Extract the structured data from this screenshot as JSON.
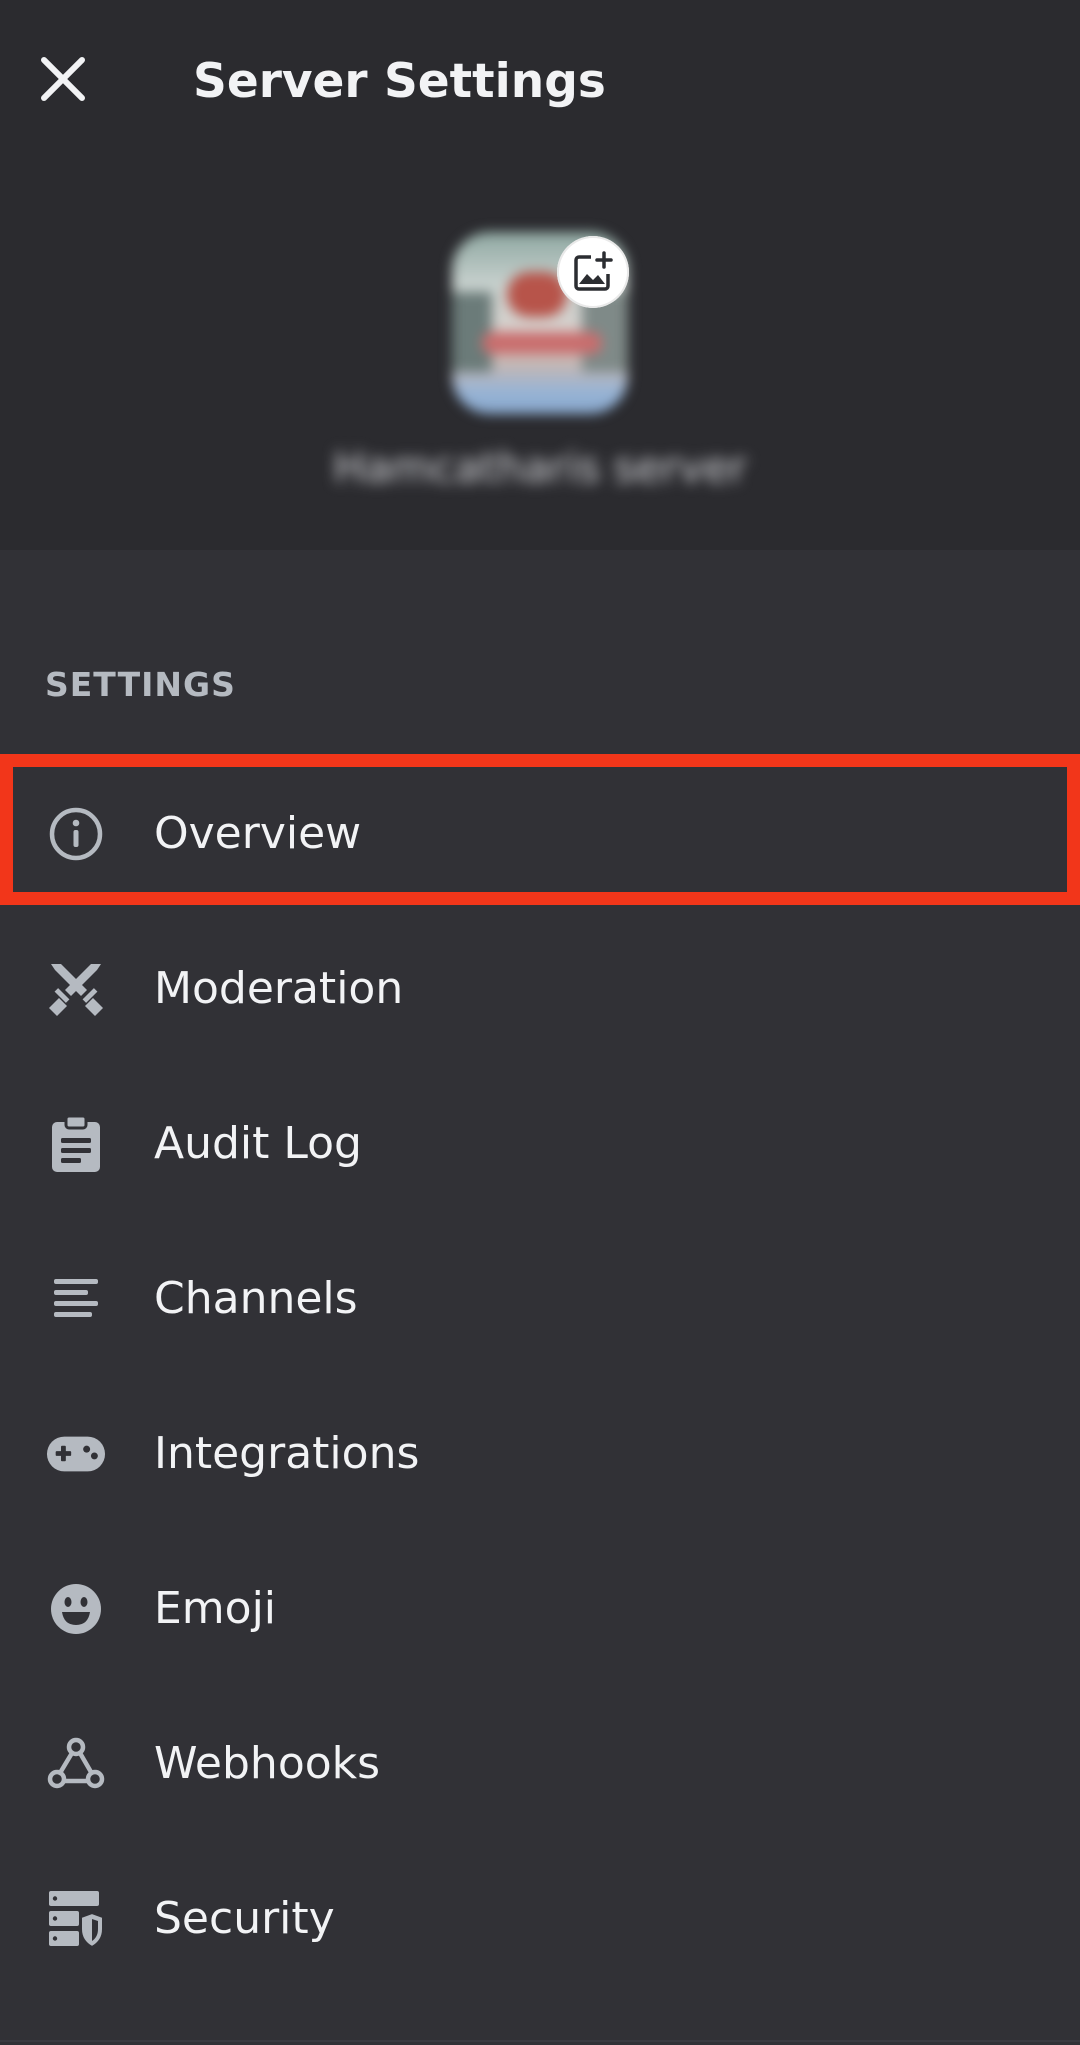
{
  "header": {
    "title": "Server Settings",
    "close_icon": "close-icon"
  },
  "server": {
    "name": "Hamcatharis server",
    "icon": "server-avatar",
    "upload_icon": "image-add-icon"
  },
  "settings_section": {
    "label": "SETTINGS",
    "items": [
      {
        "label": "Overview",
        "icon": "info-icon",
        "highlighted": true
      },
      {
        "label": "Moderation",
        "icon": "swords-icon"
      },
      {
        "label": "Audit Log",
        "icon": "clipboard-icon"
      },
      {
        "label": "Channels",
        "icon": "text-lines-icon"
      },
      {
        "label": "Integrations",
        "icon": "gamepad-icon"
      },
      {
        "label": "Emoji",
        "icon": "emoji-icon"
      },
      {
        "label": "Webhooks",
        "icon": "webhook-icon"
      },
      {
        "label": "Security",
        "icon": "server-shield-icon"
      }
    ]
  },
  "colors": {
    "background": "#313136",
    "header_background": "#2b2b2f",
    "text": "#f2f3f5",
    "muted": "#b5bac1",
    "icon": "#b5bac1",
    "highlight": "#f2361a"
  }
}
